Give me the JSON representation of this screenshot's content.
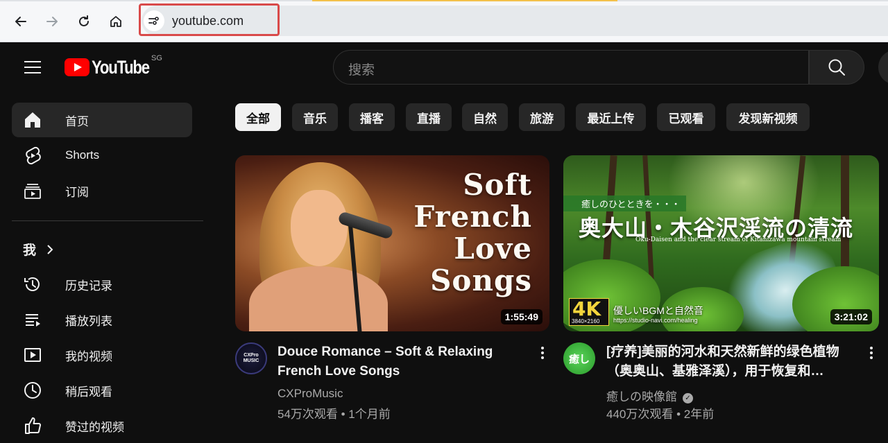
{
  "browser": {
    "url": "youtube.com"
  },
  "header": {
    "logo_text": "YouTube",
    "region": "SG",
    "search_placeholder": "搜索"
  },
  "sidebar": {
    "items": [
      {
        "label": "首页",
        "icon": "home-icon"
      },
      {
        "label": "Shorts",
        "icon": "shorts-icon"
      },
      {
        "label": "订阅",
        "icon": "subscriptions-icon"
      }
    ],
    "me_label": "我",
    "me_items": [
      {
        "label": "历史记录",
        "icon": "history-icon"
      },
      {
        "label": "播放列表",
        "icon": "playlist-icon"
      },
      {
        "label": "我的视频",
        "icon": "my-videos-icon"
      },
      {
        "label": "稍后观看",
        "icon": "watch-later-icon"
      },
      {
        "label": "赞过的视频",
        "icon": "like-icon"
      }
    ]
  },
  "chips": [
    "全部",
    "音乐",
    "播客",
    "直播",
    "自然",
    "旅游",
    "最近上传",
    "已观看",
    "发现新视频"
  ],
  "videos": [
    {
      "cover_text": [
        "Soft",
        "French",
        "Love",
        "Songs"
      ],
      "duration": "1:55:49",
      "title_line1": "Douce Romance – Soft & Relaxing",
      "title_line2": "French Love Songs",
      "channel": "CXProMusic",
      "meta": "54万次观看 • 1个月前",
      "avatar_text": "CXPro MUSIC"
    },
    {
      "thumb_tag": "癒しのひとときを・・・",
      "thumb_title": "奥大山・木谷沢渓流の清流",
      "thumb_subtitle": "Oku-Daisen and the clear stream of Kitanizawa mountain stream",
      "thumb_badge": "4K",
      "thumb_badge_res": "3840×2160",
      "thumb_bgm": "優しいBGMと自然音",
      "thumb_url": "https://studio-navi.com/healing",
      "duration": "3:21:02",
      "title_line1": "[疗养]美丽的河水和天然新鲜的绿色植物",
      "title_line2": "（奥奥山、基雅泽溪），用于恢复和…",
      "channel": "癒しの映像館",
      "meta": "440万次观看 • 2年前",
      "avatar_text": "癒し"
    }
  ]
}
